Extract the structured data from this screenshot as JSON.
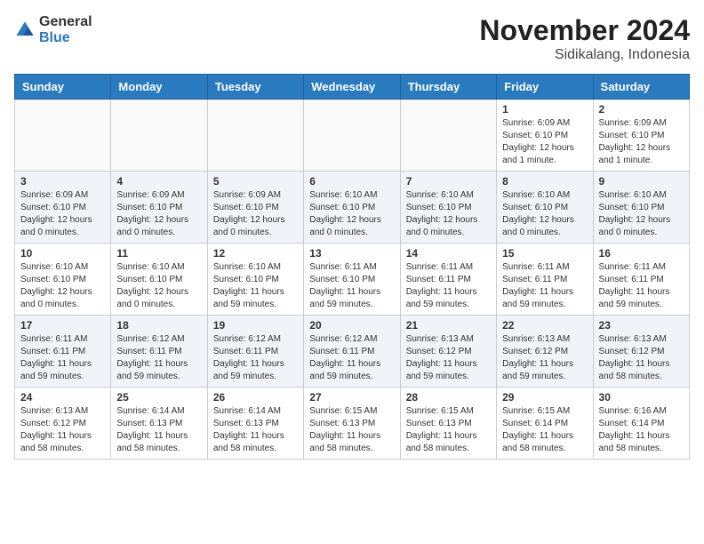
{
  "header": {
    "logo_general": "General",
    "logo_blue": "Blue",
    "title": "November 2024",
    "subtitle": "Sidikalang, Indonesia"
  },
  "calendar": {
    "days_of_week": [
      "Sunday",
      "Monday",
      "Tuesday",
      "Wednesday",
      "Thursday",
      "Friday",
      "Saturday"
    ],
    "weeks": [
      [
        {
          "day": "",
          "info": ""
        },
        {
          "day": "",
          "info": ""
        },
        {
          "day": "",
          "info": ""
        },
        {
          "day": "",
          "info": ""
        },
        {
          "day": "",
          "info": ""
        },
        {
          "day": "1",
          "info": "Sunrise: 6:09 AM\nSunset: 6:10 PM\nDaylight: 12 hours and 1 minute."
        },
        {
          "day": "2",
          "info": "Sunrise: 6:09 AM\nSunset: 6:10 PM\nDaylight: 12 hours and 1 minute."
        }
      ],
      [
        {
          "day": "3",
          "info": "Sunrise: 6:09 AM\nSunset: 6:10 PM\nDaylight: 12 hours and 0 minutes."
        },
        {
          "day": "4",
          "info": "Sunrise: 6:09 AM\nSunset: 6:10 PM\nDaylight: 12 hours and 0 minutes."
        },
        {
          "day": "5",
          "info": "Sunrise: 6:09 AM\nSunset: 6:10 PM\nDaylight: 12 hours and 0 minutes."
        },
        {
          "day": "6",
          "info": "Sunrise: 6:10 AM\nSunset: 6:10 PM\nDaylight: 12 hours and 0 minutes."
        },
        {
          "day": "7",
          "info": "Sunrise: 6:10 AM\nSunset: 6:10 PM\nDaylight: 12 hours and 0 minutes."
        },
        {
          "day": "8",
          "info": "Sunrise: 6:10 AM\nSunset: 6:10 PM\nDaylight: 12 hours and 0 minutes."
        },
        {
          "day": "9",
          "info": "Sunrise: 6:10 AM\nSunset: 6:10 PM\nDaylight: 12 hours and 0 minutes."
        }
      ],
      [
        {
          "day": "10",
          "info": "Sunrise: 6:10 AM\nSunset: 6:10 PM\nDaylight: 12 hours and 0 minutes."
        },
        {
          "day": "11",
          "info": "Sunrise: 6:10 AM\nSunset: 6:10 PM\nDaylight: 12 hours and 0 minutes."
        },
        {
          "day": "12",
          "info": "Sunrise: 6:10 AM\nSunset: 6:10 PM\nDaylight: 11 hours and 59 minutes."
        },
        {
          "day": "13",
          "info": "Sunrise: 6:11 AM\nSunset: 6:10 PM\nDaylight: 11 hours and 59 minutes."
        },
        {
          "day": "14",
          "info": "Sunrise: 6:11 AM\nSunset: 6:11 PM\nDaylight: 11 hours and 59 minutes."
        },
        {
          "day": "15",
          "info": "Sunrise: 6:11 AM\nSunset: 6:11 PM\nDaylight: 11 hours and 59 minutes."
        },
        {
          "day": "16",
          "info": "Sunrise: 6:11 AM\nSunset: 6:11 PM\nDaylight: 11 hours and 59 minutes."
        }
      ],
      [
        {
          "day": "17",
          "info": "Sunrise: 6:11 AM\nSunset: 6:11 PM\nDaylight: 11 hours and 59 minutes."
        },
        {
          "day": "18",
          "info": "Sunrise: 6:12 AM\nSunset: 6:11 PM\nDaylight: 11 hours and 59 minutes."
        },
        {
          "day": "19",
          "info": "Sunrise: 6:12 AM\nSunset: 6:11 PM\nDaylight: 11 hours and 59 minutes."
        },
        {
          "day": "20",
          "info": "Sunrise: 6:12 AM\nSunset: 6:11 PM\nDaylight: 11 hours and 59 minutes."
        },
        {
          "day": "21",
          "info": "Sunrise: 6:13 AM\nSunset: 6:12 PM\nDaylight: 11 hours and 59 minutes."
        },
        {
          "day": "22",
          "info": "Sunrise: 6:13 AM\nSunset: 6:12 PM\nDaylight: 11 hours and 59 minutes."
        },
        {
          "day": "23",
          "info": "Sunrise: 6:13 AM\nSunset: 6:12 PM\nDaylight: 11 hours and 58 minutes."
        }
      ],
      [
        {
          "day": "24",
          "info": "Sunrise: 6:13 AM\nSunset: 6:12 PM\nDaylight: 11 hours and 58 minutes."
        },
        {
          "day": "25",
          "info": "Sunrise: 6:14 AM\nSunset: 6:13 PM\nDaylight: 11 hours and 58 minutes."
        },
        {
          "day": "26",
          "info": "Sunrise: 6:14 AM\nSunset: 6:13 PM\nDaylight: 11 hours and 58 minutes."
        },
        {
          "day": "27",
          "info": "Sunrise: 6:15 AM\nSunset: 6:13 PM\nDaylight: 11 hours and 58 minutes."
        },
        {
          "day": "28",
          "info": "Sunrise: 6:15 AM\nSunset: 6:13 PM\nDaylight: 11 hours and 58 minutes."
        },
        {
          "day": "29",
          "info": "Sunrise: 6:15 AM\nSunset: 6:14 PM\nDaylight: 11 hours and 58 minutes."
        },
        {
          "day": "30",
          "info": "Sunrise: 6:16 AM\nSunset: 6:14 PM\nDaylight: 11 hours and 58 minutes."
        }
      ]
    ]
  }
}
